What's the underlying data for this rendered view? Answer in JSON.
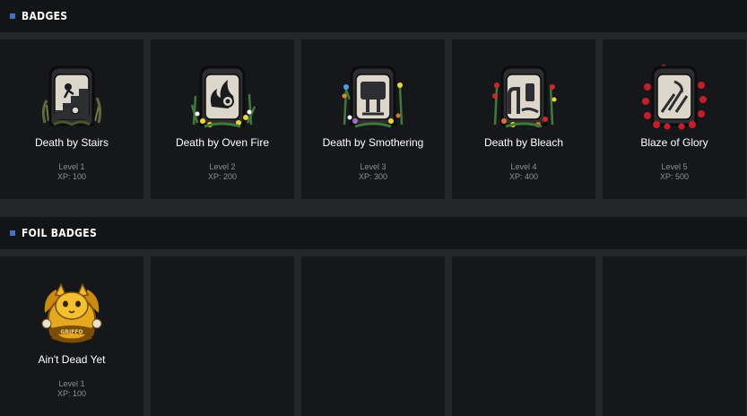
{
  "badges_section": {
    "title": "BADGES",
    "items": [
      {
        "name": "Death by Stairs",
        "level": "Level 1",
        "xp": "XP: 100",
        "icon": "stairs-tombstone-badge-icon"
      },
      {
        "name": "Death by Oven Fire",
        "level": "Level 2",
        "xp": "XP: 200",
        "icon": "fire-tombstone-badge-icon"
      },
      {
        "name": "Death by Smothering",
        "level": "Level 3",
        "xp": "XP: 300",
        "icon": "pillow-tombstone-badge-icon"
      },
      {
        "name": "Death by Bleach",
        "level": "Level 4",
        "xp": "XP: 400",
        "icon": "bleach-tombstone-badge-icon"
      },
      {
        "name": "Blaze of Glory",
        "level": "Level 5",
        "xp": "XP: 500",
        "icon": "glory-tombstone-badge-icon"
      }
    ]
  },
  "foil_section": {
    "title": "FOIL BADGES",
    "items": [
      {
        "name": "Ain't Dead Yet",
        "level": "Level 1",
        "xp": "XP: 100",
        "icon": "gold-cat-foil-badge-icon",
        "emblem_text": "GRIFFO"
      }
    ]
  },
  "colors": {
    "accent": "#3d72c4",
    "card_bg": "#16171a",
    "header_bg": "#131416",
    "page_bg": "#252629",
    "muted_text": "#8c8f94",
    "gold": "#e0a420"
  }
}
